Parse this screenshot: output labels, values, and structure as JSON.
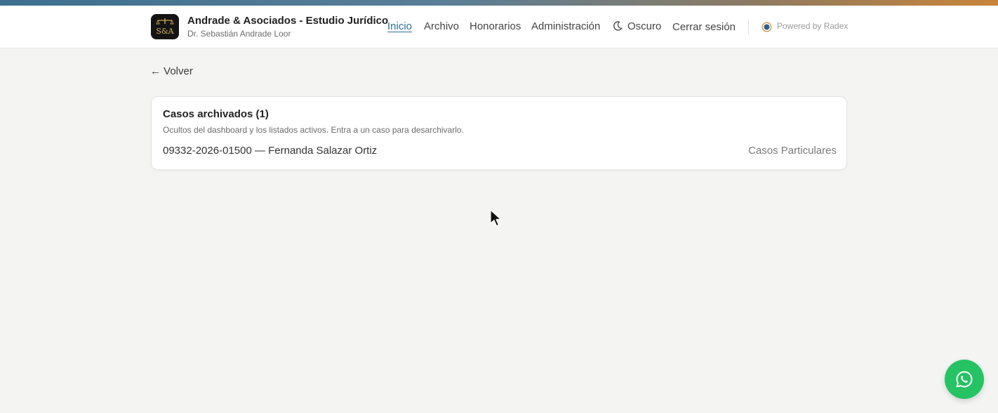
{
  "brand": {
    "title": "Andrade & Asociados - Estudio Jurídico",
    "subtitle": "Dr. Sebastián Andrade Loor",
    "logo_text": "S&A",
    "logo_icon": "scales-of-justice-icon"
  },
  "nav": {
    "inicio": "Inicio",
    "archivo": "Archivo",
    "honorarios": "Honorarios",
    "administracion": "Administración",
    "theme_toggle": "Oscuro",
    "logout": "Cerrar sesión",
    "powered": "Powered by Radex",
    "active_item": "Inicio",
    "active_color": "#2f6f9a"
  },
  "page": {
    "back_label": "← Volver"
  },
  "archived": {
    "title": "Casos archivados (1)",
    "description": "Ocultos del dashboard y los listados activos. Entra a un caso para desarchivarlo.",
    "cases": [
      {
        "label": "09332-2026-01500 — Fernanda Salazar Ortiz",
        "category": "Casos Particulares"
      }
    ]
  },
  "whatsapp": {
    "icon": "whatsapp-icon",
    "color": "#25c363"
  },
  "colors": {
    "accent_blue": "#3d6f8f",
    "accent_orange": "#c9853a"
  }
}
